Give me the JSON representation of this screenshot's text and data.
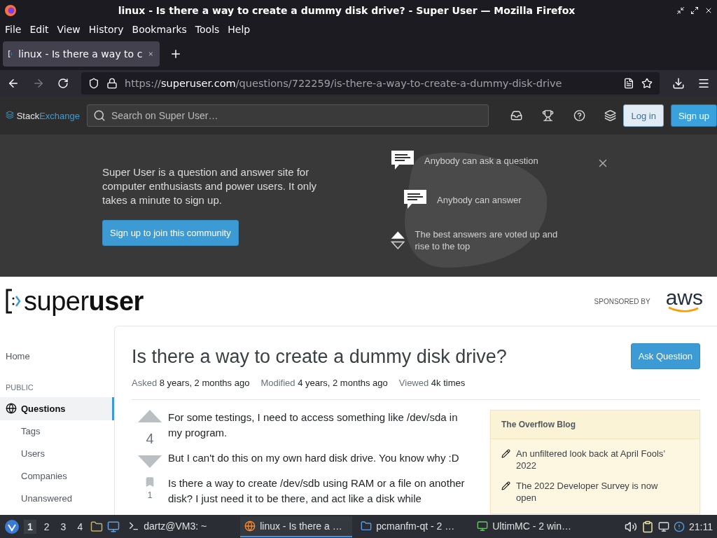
{
  "window": {
    "title": "linux - Is there a way to create a dummy disk drive? - Super User — Mozilla Firefox"
  },
  "menu": [
    "File",
    "Edit",
    "View",
    "History",
    "Bookmarks",
    "Tools",
    "Help"
  ],
  "tabs": [
    {
      "label": "linux - Is there a way to c",
      "selected": true
    }
  ],
  "address": {
    "scheme": "https://",
    "host": "superuser.com",
    "path": "/questions/722259/is-there-a-way-to-create-a-dummy-disk-drive"
  },
  "topbar": {
    "brand": [
      "Stack",
      "Exchange"
    ],
    "search": {
      "placeholder": "Search on Super User…"
    },
    "login": "Log in",
    "signup": "Sign up"
  },
  "banner": {
    "text": "Super User is a question and answer site for computer enthusiasts and power users. It only takes a minute to sign up.",
    "button": "Sign up to join this community",
    "features": [
      {
        "kind": "chat",
        "text": "Anybody can ask a question"
      },
      {
        "kind": "chat",
        "text": "Anybody can answer"
      },
      {
        "kind": "vote",
        "text": "The best answers are voted up and rise to the top"
      }
    ]
  },
  "site": {
    "logo": [
      "super",
      "user"
    ],
    "sponsor": "SPONSORED BY",
    "sponsor_logo": "aws"
  },
  "sidebar": [
    {
      "kind": "link",
      "label": "Home",
      "selected": false
    },
    {
      "kind": "heading",
      "label": "PUBLIC"
    },
    {
      "kind": "main",
      "label": "Questions",
      "selected": true
    },
    {
      "kind": "sub",
      "label": "Tags",
      "selected": false
    },
    {
      "kind": "sub",
      "label": "Users",
      "selected": false
    },
    {
      "kind": "sub",
      "label": "Companies",
      "selected": false
    },
    {
      "kind": "sub",
      "label": "Unanswered",
      "selected": false
    }
  ],
  "question": {
    "title": "Is there a way to create a dummy disk drive?",
    "ask_button": "Ask Question",
    "meta": [
      {
        "label": "Asked",
        "value": "8 years, 2 months ago"
      },
      {
        "label": "Modified",
        "value": "4 years, 2 months ago"
      },
      {
        "label": "Viewed",
        "value": "4k times"
      }
    ],
    "votes": "4",
    "bookmarks": "1",
    "paragraphs": [
      "For some testings, I need to access something like /dev/sda in my program.",
      "But I can't do this on my own hard disk drive. You know why :D",
      "Is there a way to create /dev/sdb using RAM or a file on another disk? I just need it to be there, and act like a disk while"
    ]
  },
  "blog": {
    "title": "The Overflow Blog",
    "items": [
      "An unfiltered look back at April Fools’ 2022",
      "The 2022 Developer Survey is now open"
    ]
  },
  "taskbar": {
    "workspaces": [
      {
        "label": "1",
        "selected": true
      },
      {
        "label": "2",
        "selected": false
      },
      {
        "label": "3",
        "selected": false
      },
      {
        "label": "4",
        "selected": false
      }
    ],
    "tasks": [
      {
        "kind": "terminal",
        "label": "dartz@VM3: ~",
        "selected": false
      },
      {
        "kind": "browser",
        "label": "linux - Is there a …",
        "selected": true
      },
      {
        "kind": "folder",
        "label": "pcmanfm-qt - 2 …",
        "selected": false
      },
      {
        "kind": "app",
        "label": "UltimMC - 2 win…",
        "selected": false
      }
    ],
    "clock": "21:11"
  }
}
